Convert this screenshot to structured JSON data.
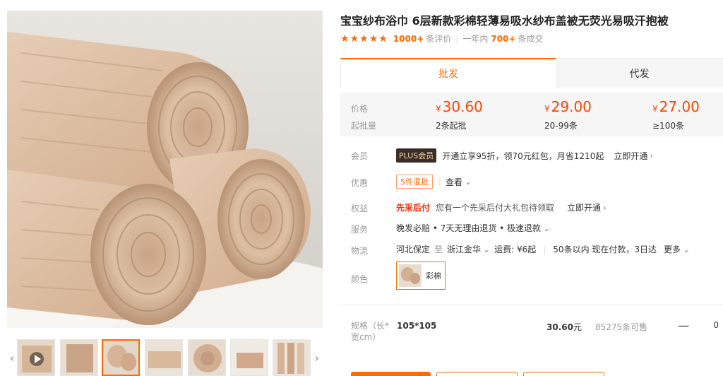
{
  "product": {
    "title": "宝宝纱布浴巾 6层新款彩棉轻薄易吸水纱布盖被无荧光易吸汗抱被"
  },
  "rating": {
    "stars": 5,
    "reviews": "1000+",
    "reviews_suffix": "条评价",
    "period": "一年内",
    "sold": "700+",
    "sold_suffix": "条成交"
  },
  "tabs": [
    {
      "label": "批发",
      "active": true
    },
    {
      "label": "代发",
      "active": false
    }
  ],
  "price_box": {
    "price_label": "价格",
    "min_label": "起批量",
    "currency": "¥",
    "tiers": [
      {
        "price": "30.60",
        "qty": "2条起批"
      },
      {
        "price": "29.00",
        "qty": "20-99条"
      },
      {
        "price": "27.00",
        "qty": "≥100条"
      }
    ]
  },
  "member": {
    "label": "会员",
    "badge": "PLUS会员",
    "text": "开通立享95折，领70元红包，月省1210起",
    "link": "立即开通"
  },
  "discount": {
    "label": "优惠",
    "tag": "5件混批",
    "link": "查看"
  },
  "rights": {
    "label": "权益",
    "highlight": "先采后付",
    "text": "您有一个先采后付大礼包待领取",
    "link": "立即开通"
  },
  "service": {
    "label": "服务",
    "text": "晚发必赔 • 7天无理由退货 • 极速退款"
  },
  "logistics": {
    "label": "物流",
    "from": "河北保定",
    "to_word": "至",
    "to": "浙江金华",
    "fee_label": "运费: ¥6起",
    "delivery": "50条以内 现在付款，3日达",
    "more": "更多"
  },
  "color": {
    "label": "颜色",
    "option": "彩棉"
  },
  "spec": {
    "label": "规格（长*宽cm）",
    "value": "105*105",
    "price": "30.60",
    "price_unit": "元",
    "stock": "85275条可售",
    "minus": "—",
    "qty": "0"
  },
  "colors": {
    "accent": "#ff6a00",
    "price_red": "#ff4400",
    "towel": "#d9b99a"
  }
}
